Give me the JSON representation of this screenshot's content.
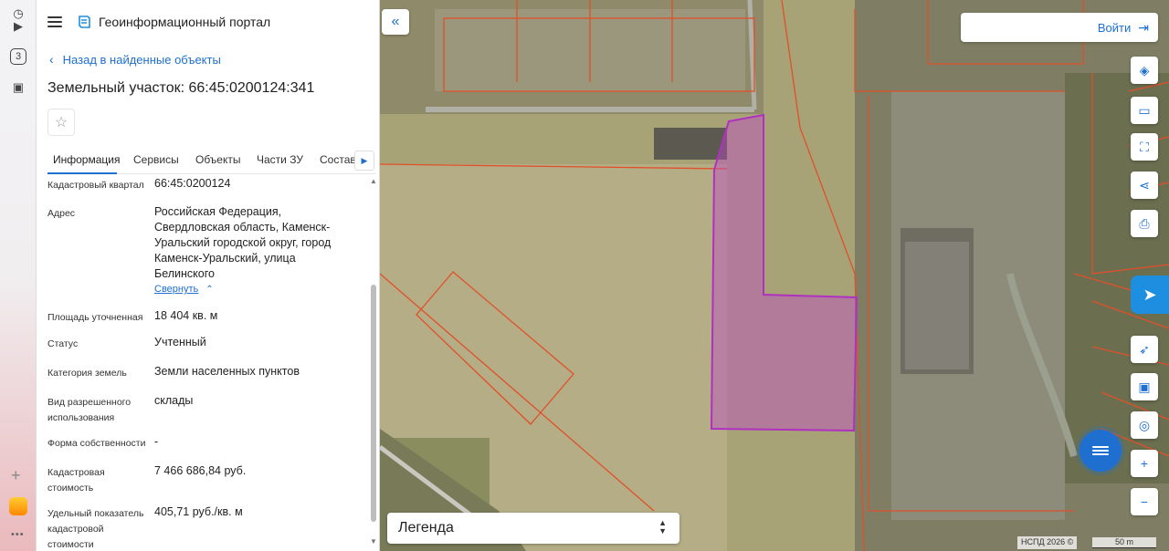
{
  "app": {
    "title": "Геоинформационный портал"
  },
  "panel": {
    "back_label": "Назад в найденные объекты",
    "title": "Земельный участок: 66:45:0200124:341",
    "tabs": [
      "Информация",
      "Сервисы",
      "Объекты",
      "Части ЗУ",
      "Состав"
    ],
    "active_tab": "Информация",
    "collapse_label": "Свернуть",
    "fields": [
      {
        "label": "Кадастровый квартал",
        "value": "66:45:0200124"
      },
      {
        "label": "Адрес",
        "value": "Российская Федерация, Свердловская область, Каменск-Уральский городской округ, город Каменск-Уральский, улица Белинского"
      },
      {
        "label": "Площадь уточненная",
        "value": "18 404 кв. м"
      },
      {
        "label": "Статус",
        "value": "Учтенный"
      },
      {
        "label": "Категория земель",
        "value": "Земли населенных пунктов"
      },
      {
        "label": "Вид разрешенного использования",
        "value": "склады"
      },
      {
        "label": "Форма собственности",
        "value": "-"
      },
      {
        "label": "Кадастровая стоимость",
        "value": "7 466 686,84 руб."
      },
      {
        "label": "Удельный показатель кадастровой стоимости",
        "value": "405,71 руб./кв. м"
      }
    ]
  },
  "map": {
    "login_label": "Войти",
    "legend_label": "Легенда",
    "attribution": "НСПД 2026 ©",
    "scale_label": "50 m",
    "highlight_color": "#b030c0",
    "parcel_line_color": "#e0502a",
    "tools": [
      "layers-icon",
      "ruler-icon",
      "select-area-icon",
      "share-icon",
      "print-icon",
      "locate-icon",
      "minimap-icon",
      "geo-search-icon",
      "zoom-in-icon",
      "zoom-out-icon"
    ]
  },
  "sidebar": {
    "icons": [
      "browser-icon",
      "play-icon",
      "number-icon",
      "image-icon"
    ],
    "number_badge": "3"
  }
}
